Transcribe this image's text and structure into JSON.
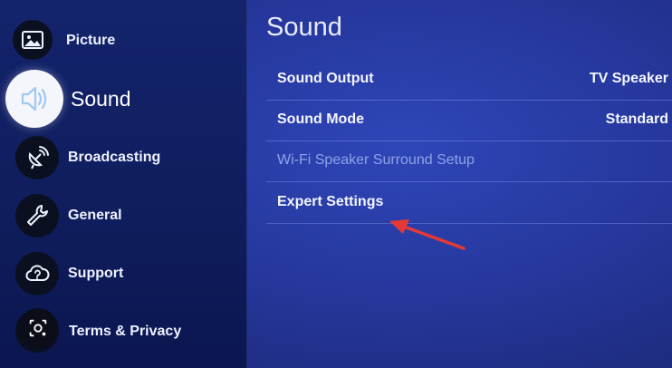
{
  "sidebar": {
    "items": [
      {
        "label": "Picture",
        "icon": "picture-icon"
      },
      {
        "label": "Sound",
        "icon": "speaker-icon",
        "selected": true
      },
      {
        "label": "Broadcasting",
        "icon": "satellite-dish-icon"
      },
      {
        "label": "General",
        "icon": "wrench-icon"
      },
      {
        "label": "Support",
        "icon": "cloud-question-icon"
      },
      {
        "label": "Terms & Privacy",
        "icon": "shield-icon"
      }
    ]
  },
  "panel": {
    "title": "Sound",
    "rows": [
      {
        "label": "Sound Output",
        "value": "TV Speaker"
      },
      {
        "label": "Sound Mode",
        "value": "Standard"
      },
      {
        "label": "Wi-Fi Speaker Surround Setup",
        "value": "",
        "disabled": true
      },
      {
        "label": "Expert Settings",
        "value": ""
      }
    ]
  },
  "colors": {
    "accent_arrow": "#e53935",
    "panel_bg": "#2a3fad",
    "sidebar_bg": "#12225f"
  }
}
